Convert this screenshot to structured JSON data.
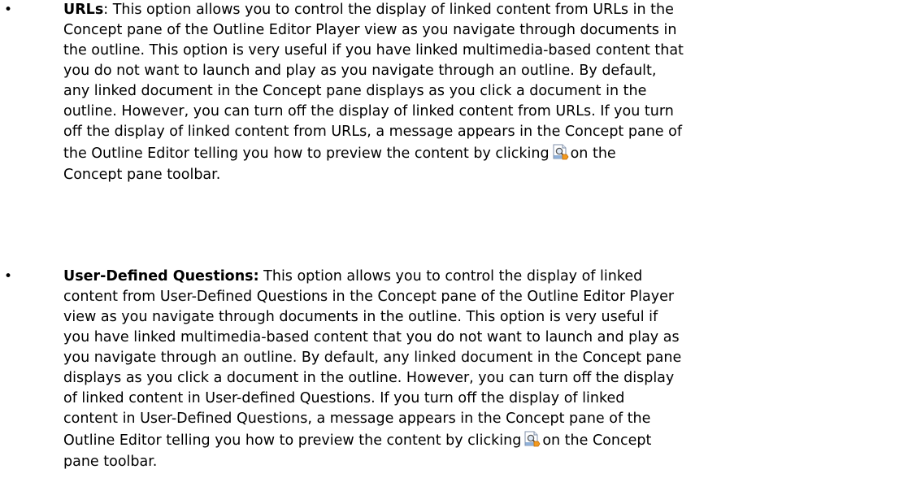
{
  "items": [
    {
      "bullet": "•",
      "term": "URLs",
      "lines": [
        ": This option allows you to control the display of linked content from URLs in the",
        "Concept pane of the Outline Editor Player view as you navigate through documents in",
        "the outline. This option is very useful if you have linked multimedia-based content that",
        "you do not want to launch and play as you navigate through an outline. By default,",
        "any linked document in the Concept pane displays as you click a document in the",
        "outline. However, you can turn off the display of linked content from URLs. If you turn",
        "off the display of linked content from URLs, a message appears in the Concept pane of",
        "the Outline Editor telling you how to preview the content by clicking",
        "on the",
        "Concept pane toolbar."
      ],
      "icon": "preview-icon"
    },
    {
      "bullet": "•",
      "term": "User-Defined Questions:",
      "lines": [
        " This option allows you to control the display of linked",
        "content from User-Defined Questions in the Concept pane of the Outline Editor Player",
        "view as you navigate through documents in the outline. This option is very useful if",
        "you have linked multimedia-based content that you do not want to launch and play as",
        "you navigate through an outline. By default, any linked document in the Concept pane",
        "displays as you click a document in the outline. However, you can turn off the display",
        "of linked content in User-defined Questions. If you turn off the display of linked",
        "content in User-Defined Questions, a message appears in the Concept pane of the",
        "Outline Editor telling you how to preview the content by clicking",
        "on the Concept",
        "pane toolbar."
      ],
      "icon": "preview-icon"
    }
  ]
}
